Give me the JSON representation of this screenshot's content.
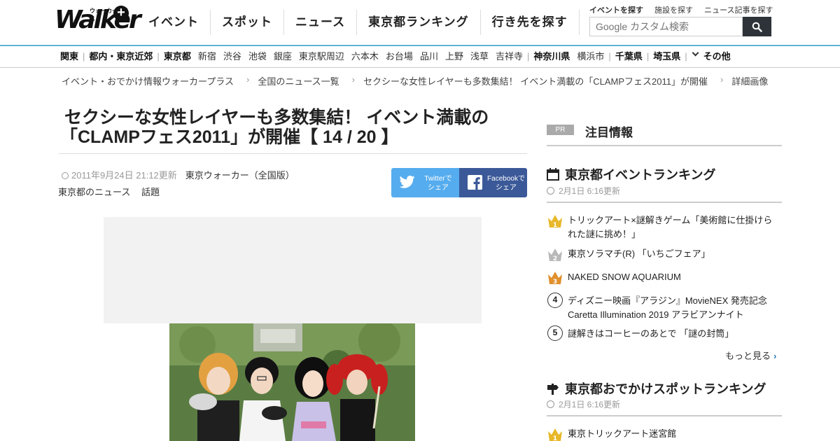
{
  "header": {
    "logo_text": "Walker",
    "logo_sub": "ウォーカープラス",
    "logo_plus": "+",
    "nav": [
      "イベント",
      "スポット",
      "ニュース",
      "東京都ランキング",
      "行き先を探す"
    ],
    "links": [
      "イベントを探す",
      "施設を探す",
      "ニュース記事を探す"
    ],
    "search_placeholder": "Google カスタム検索"
  },
  "subnav": {
    "items": [
      {
        "label": "関東",
        "bold": true,
        "sep": true
      },
      {
        "label": "都内・東京近郊",
        "bold": true,
        "sep": true
      },
      {
        "label": "東京都",
        "bold": true,
        "sep": false
      },
      {
        "label": "新宿"
      },
      {
        "label": "渋谷"
      },
      {
        "label": "池袋"
      },
      {
        "label": "銀座"
      },
      {
        "label": "東京駅周辺"
      },
      {
        "label": "六本木"
      },
      {
        "label": "お台場"
      },
      {
        "label": "品川"
      },
      {
        "label": "上野"
      },
      {
        "label": "浅草"
      },
      {
        "label": "吉祥寺",
        "sep": true
      },
      {
        "label": "神奈川県",
        "bold": true,
        "sep": false
      },
      {
        "label": "横浜市",
        "sep": true
      },
      {
        "label": "千葉県",
        "bold": true,
        "sep": true
      },
      {
        "label": "埼玉県",
        "bold": true,
        "sep": true
      },
      {
        "label": "その他",
        "bold": true,
        "chevron": true
      }
    ]
  },
  "breadcrumb": [
    "イベント・おでかけ情報ウォーカープラス",
    "全国のニュース一覧",
    "セクシーな女性レイヤーも多数集結！ イベント満載の「CLAMPフェス2011」が開催",
    "詳細画像"
  ],
  "article": {
    "title_line1": "セクシーな女性レイヤーも多数集結！ イベント満載の",
    "title_line2": "「CLAMPフェス2011」が開催【 14 / 20 】",
    "date": "2011年9月24日 21:12更新",
    "source": "東京ウォーカー（全国版）",
    "tags": [
      "東京都のニュース",
      "話題"
    ],
    "share_twitter": "Twitterで\nシェア",
    "share_twitter_1": "Twitterで",
    "share_twitter_2": "シェア",
    "share_facebook_1": "Facebookで",
    "share_facebook_2": "シェア"
  },
  "sidebar": {
    "pr_tag": "PR",
    "pr_title": "注目情報",
    "event_ranking": {
      "title": "東京都イベントランキング",
      "updated": "2月1日 6:16更新",
      "items": [
        {
          "rank": "1",
          "text": "トリックアート×謎解きゲーム「美術館に仕掛けられた謎に挑め！」"
        },
        {
          "rank": "2",
          "text": "東京ソラマチ(R) 「いちごフェア」"
        },
        {
          "rank": "3",
          "text": "NAKED SNOW AQUARIUM"
        },
        {
          "rank": "4",
          "text": "ディズニー映画『アラジン』MovieNEX 発売記念 Caretta Illumination 2019 アラビアンナイト"
        },
        {
          "rank": "5",
          "text": "謎解きはコーヒーのあとで 「謎の封筒」"
        }
      ],
      "more": "もっと見る"
    },
    "spot_ranking": {
      "title": "東京都おでかけスポットランキング",
      "updated": "2月1日 6:16更新",
      "items": [
        {
          "rank": "1",
          "text": "東京トリックアート迷宮館"
        }
      ]
    }
  },
  "colors": {
    "accent_blue": "#5fb3d6",
    "twitter": "#55acee",
    "facebook": "#3b5998",
    "gold": "#e8b82a",
    "silver": "#b8b8b8",
    "bronze": "#e0902c"
  }
}
